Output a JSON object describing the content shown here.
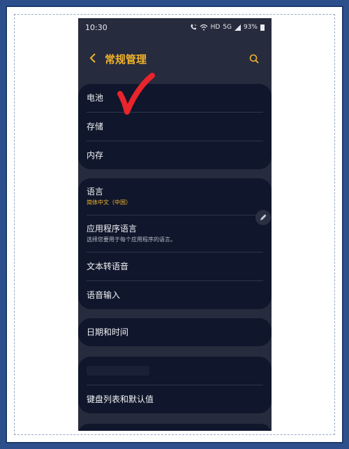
{
  "status_bar": {
    "time": "10:30",
    "hd_label": "HD",
    "signal_label": "5G",
    "battery": "93%"
  },
  "header": {
    "title": "常规管理",
    "back_icon": "chevron-left-icon",
    "search_icon": "search-icon"
  },
  "groups": [
    {
      "items": [
        {
          "label": "电池"
        },
        {
          "label": "存储"
        },
        {
          "label": "内存"
        }
      ]
    },
    {
      "items": [
        {
          "label": "语言",
          "sub": "简体中文（中国）"
        },
        {
          "label": "应用程序语言",
          "desc": "选择您要用于每个应用程序的语言。"
        },
        {
          "label": "文本转语音"
        },
        {
          "label": "语音输入"
        }
      ]
    },
    {
      "items": [
        {
          "label": "日期和时间"
        }
      ]
    },
    {
      "items": [
        {
          "label": "键盘列表和默认值"
        }
      ]
    }
  ],
  "colors": {
    "accent": "#f2b32a",
    "card_bg": "#10162b",
    "screen_bg": "#262b3d",
    "checkmark": "#e8242c"
  }
}
